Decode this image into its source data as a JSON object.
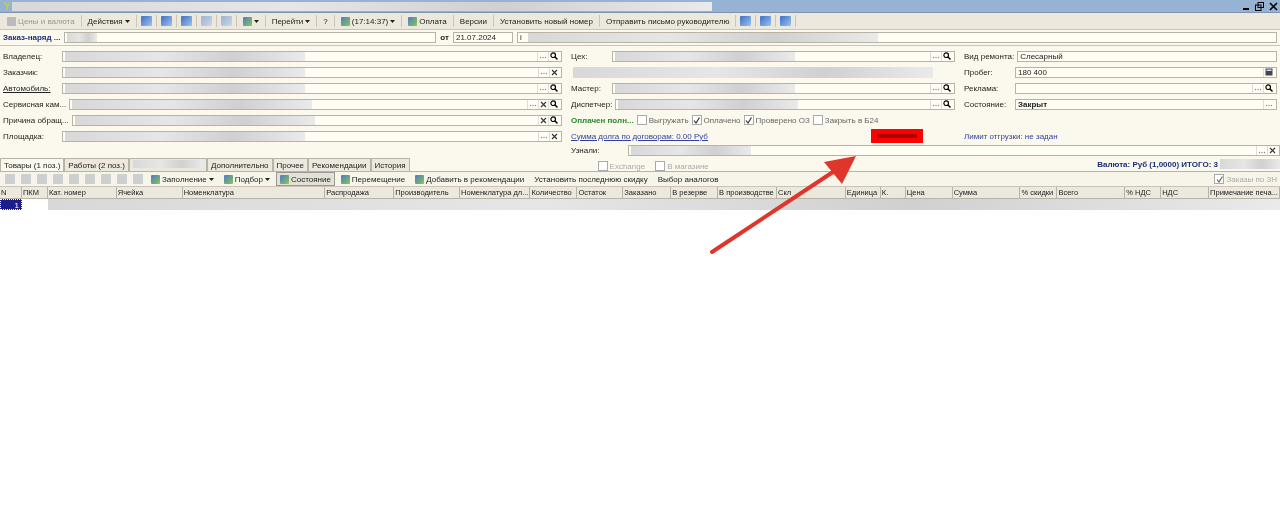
{
  "toolbar": [
    {
      "kind": "icon-text",
      "label": "Цены и валюта",
      "disabled": true
    },
    {
      "kind": "menu",
      "label": "Действия",
      "disabled": false
    },
    {
      "kind": "icon",
      "disabled": false
    },
    {
      "kind": "icon",
      "disabled": false
    },
    {
      "kind": "icon",
      "disabled": false
    },
    {
      "kind": "icon",
      "disabled": true
    },
    {
      "kind": "icon",
      "disabled": true
    },
    {
      "kind": "icon-menu",
      "disabled": false
    },
    {
      "kind": "menu",
      "label": "Перейти",
      "disabled": false
    },
    {
      "kind": "text",
      "label": "?",
      "disabled": false
    },
    {
      "kind": "icon-menu",
      "label": "(17:14:37)",
      "disabled": false
    },
    {
      "kind": "icon-text",
      "label": "Оплата",
      "disabled": false
    },
    {
      "kind": "text",
      "label": "Версии",
      "disabled": false
    },
    {
      "kind": "text",
      "label": "Установить новый номер",
      "disabled": false
    },
    {
      "kind": "text",
      "label": "Отправить письмо руководителю",
      "disabled": false
    },
    {
      "kind": "icon",
      "disabled": false
    },
    {
      "kind": "icon",
      "disabled": false
    },
    {
      "kind": "icon",
      "disabled": false
    }
  ],
  "header": {
    "title": "Заказ-наряд ...",
    "date_label": "от",
    "date": "21.07.2024",
    "field_text": "i"
  },
  "left_fields": [
    {
      "label": "Владелец:",
      "link": false,
      "kind": "lookup"
    },
    {
      "label": "Заказчик:",
      "link": false,
      "kind": "choice"
    },
    {
      "label": "Автомобиль:",
      "link": true,
      "kind": "lookup"
    },
    {
      "label": "Сервисная кам...",
      "link": false,
      "kind": "full"
    },
    {
      "label": "Причина обращ...",
      "link": false,
      "kind": "clearable"
    },
    {
      "label": "Площадка:",
      "link": false,
      "kind": "choice"
    }
  ],
  "middle_fields": [
    {
      "label": "Цех:",
      "kind": "lookup"
    },
    {
      "kind": "blurred"
    },
    {
      "label": "Мастер:",
      "kind": "lookup"
    },
    {
      "label": "Диспетчер:",
      "kind": "lookup"
    }
  ],
  "payment_status": "Оплачен полн...",
  "flags": [
    {
      "label": "Выгружать",
      "checked": false
    },
    {
      "label": "Оплачено",
      "checked": true
    },
    {
      "label": "Проверено ОЗ",
      "checked": true
    },
    {
      "label": "Закрыть в Б24",
      "checked": false
    }
  ],
  "debt_link": "Сумма долга по договорам: 0.00 Руб",
  "source": {
    "label": "Узнали:",
    "kind": "choice"
  },
  "source_flags": [
    {
      "label": "Exchange",
      "checked": false
    },
    {
      "label": "В магазине",
      "checked": false
    }
  ],
  "right_fields": [
    {
      "label": "Вид ремонта:",
      "value": "Слесарный",
      "kind": "plain",
      "bold": false
    },
    {
      "label": "Пробег:",
      "value": "180 400",
      "kind": "number",
      "bold": false
    },
    {
      "label": "Реклама:",
      "kind": "lookup"
    },
    {
      "label": "Состояние:",
      "value": "Закрыт",
      "kind": "dropdown",
      "bold": true
    }
  ],
  "shipment_limit": "Лимит отгрузки: не задан",
  "total": "Валюта: Руб (1,0000) ИТОГО: 3",
  "tabs": [
    {
      "kind": "text",
      "label": "Товары (1 поз.)",
      "selected": true
    },
    {
      "kind": "text",
      "label": "Работы (2 поз.)",
      "selected": false
    },
    {
      "kind": "blurred",
      "selected": false
    },
    {
      "kind": "text",
      "label": "Дополнительно",
      "selected": false
    },
    {
      "kind": "text",
      "label": "Прочее",
      "selected": false
    },
    {
      "kind": "text",
      "label": "Рекомендации",
      "selected": false
    },
    {
      "kind": "text",
      "label": "История",
      "selected": false
    }
  ],
  "table_toolbar": [
    {
      "kind": "icon",
      "disabled": true
    },
    {
      "kind": "icon",
      "disabled": true
    },
    {
      "kind": "icon",
      "disabled": true
    },
    {
      "kind": "icon",
      "disabled": true
    },
    {
      "kind": "icon",
      "disabled": true
    },
    {
      "kind": "icon",
      "disabled": true
    },
    {
      "kind": "icon",
      "disabled": true
    },
    {
      "kind": "icon",
      "disabled": true
    },
    {
      "kind": "icon",
      "disabled": true
    },
    {
      "kind": "icon-menu",
      "label": "Заполнение",
      "pressed": false
    },
    {
      "kind": "icon-menu",
      "label": "Подбор",
      "pressed": false
    },
    {
      "kind": "icon-text",
      "label": "Состояние",
      "pressed": true
    },
    {
      "kind": "icon-text",
      "label": "Перемещение",
      "pressed": false
    },
    {
      "kind": "icon-text",
      "label": "Добавить в рекомендации",
      "pressed": false
    },
    {
      "kind": "text",
      "label": "Установить последнюю скидку",
      "pressed": false
    },
    {
      "kind": "text",
      "label": "Выбор аналогов",
      "pressed": false
    }
  ],
  "orders_by_wo": {
    "label": "Заказы по ЗН",
    "checked": true
  },
  "table": {
    "columns": [
      "N",
      "ПКМ",
      "Кат. номер",
      "Ячейка",
      "Номенклатура",
      "Распродажа",
      "Производитель",
      "Номенклатура дл...",
      "Количество",
      "Остаток",
      "Заказано",
      "В резерве",
      "В производстве",
      "Скл",
      "Единица",
      "К.",
      "Цена",
      "Сумма",
      "% скидки",
      "Всего",
      "% НДС",
      "НДС",
      "Примечание печа..."
    ],
    "rows": [
      {
        "n": "1",
        "selected": true
      }
    ]
  }
}
